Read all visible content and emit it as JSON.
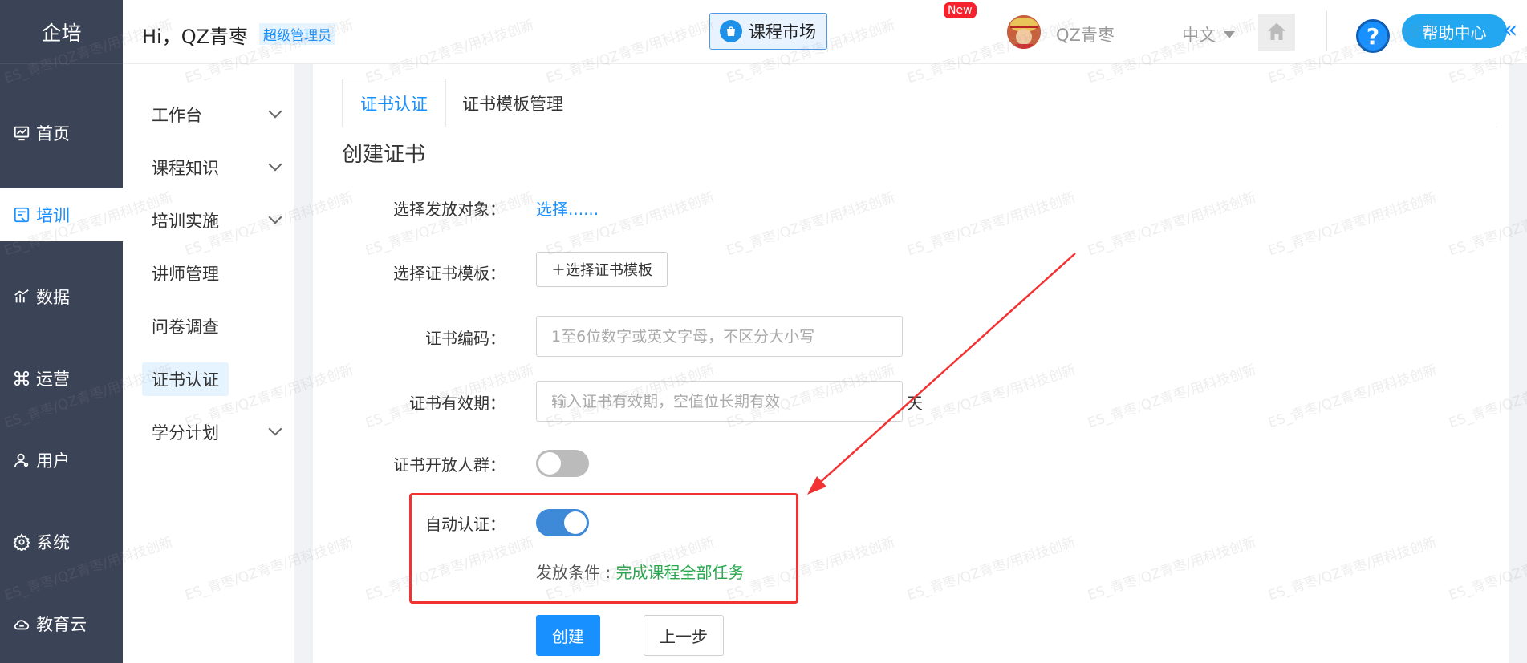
{
  "nav": {
    "brand": "企培",
    "items": [
      {
        "label": "首页",
        "icon": "dashboard-icon"
      },
      {
        "label": "培训",
        "icon": "training-icon",
        "active": true
      },
      {
        "label": "数据",
        "icon": "chart-icon"
      },
      {
        "label": "运营",
        "icon": "operations-icon"
      },
      {
        "label": "用户",
        "icon": "user-icon"
      },
      {
        "label": "系统",
        "icon": "gear-icon"
      },
      {
        "label": "教育云",
        "icon": "cloud-icon"
      }
    ]
  },
  "header": {
    "greeting": "Hi，QZ青枣",
    "role_badge": "超级管理员",
    "market_label": "课程市场",
    "new_badge": "New",
    "username": "QZ青枣",
    "language": "中文",
    "help_label": "帮助中心",
    "help_icon_text": "?",
    "collapse_symbol": "«"
  },
  "submenu": {
    "items": [
      {
        "label": "工作台",
        "has_children": true
      },
      {
        "label": "课程知识",
        "has_children": true
      },
      {
        "label": "培训实施",
        "has_children": true
      },
      {
        "label": "讲师管理",
        "has_children": false
      },
      {
        "label": "问卷调查",
        "has_children": false
      },
      {
        "label": "证书认证",
        "has_children": false,
        "active": true
      },
      {
        "label": "学分计划",
        "has_children": true
      }
    ]
  },
  "main": {
    "tabs": [
      {
        "label": "证书认证",
        "active": true
      },
      {
        "label": "证书模板管理",
        "active": false
      }
    ],
    "page_title": "创建证书",
    "form": {
      "target_label": "选择发放对象：",
      "target_link": "选择......",
      "template_label": "选择证书模板：",
      "template_button": "＋选择证书模板",
      "code_label": "证书编码：",
      "code_placeholder": "1至6位数字或英文字母，不区分大小写",
      "validity_label": "证书有效期：",
      "validity_placeholder": "输入证书有效期，空值位长期有效",
      "validity_unit": "天",
      "open_label": "证书开放人群：",
      "open_enabled": false,
      "auto_label": "自动认证：",
      "auto_enabled": true,
      "condition_label": "发放条件 :",
      "condition_value": "完成课程全部任务",
      "create_button": "创建",
      "prev_button": "上一步"
    }
  },
  "watermark_text": "ES_青枣/QZ青枣/用科技创新",
  "colors": {
    "primary": "#1890ff",
    "sidebar": "#3b4357",
    "highlight": "#f23232",
    "success": "#2aa64e"
  }
}
